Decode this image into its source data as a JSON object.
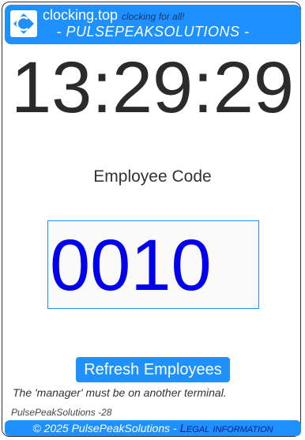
{
  "header": {
    "site_name": "clocking.top",
    "tagline": "clocking for all!",
    "company_title": "- PULSEPEAKSOLUTIONS -"
  },
  "clock": {
    "time": "13:29:29"
  },
  "employee": {
    "label": "Employee Code",
    "code_value": "0010"
  },
  "actions": {
    "refresh_label": "Refresh Employees"
  },
  "status": {
    "message": "The 'manager' must be on another terminal.",
    "terminal_id": "PulsePeakSolutions -28"
  },
  "footer": {
    "copyright": "© 2025 PulsePeakSolutions - ",
    "legal_link": "Legal information"
  },
  "colors": {
    "accent": "#1e90ff",
    "code_text": "#0000ee",
    "clock_text": "#2b2b2b"
  }
}
